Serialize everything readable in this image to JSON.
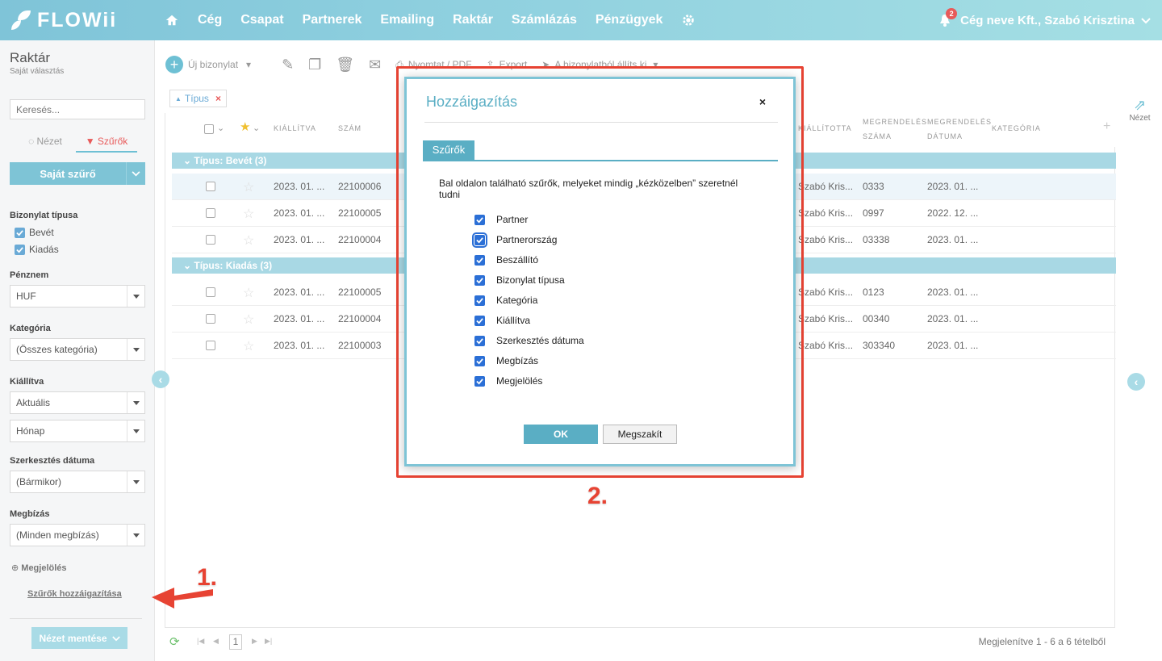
{
  "brand": {
    "name": "FLOWii",
    "accent": "#7ec4d6",
    "alert": "#e74333"
  },
  "nav": {
    "items": [
      "Cég",
      "Csapat",
      "Partnerek",
      "Emailing",
      "Raktár",
      "Számlázás",
      "Pénzügyek"
    ]
  },
  "user": {
    "label": "Cég neve Kft., Szabó Krisztina",
    "notifications": "2"
  },
  "sidebar": {
    "title": "Raktár",
    "subtitle": "Saját választás",
    "search_placeholder": "Keresés...",
    "tab_view": "Nézet",
    "tab_filters": "Szűrők",
    "own_filter": "Saját szűrő",
    "doc_type_label": "Bizonylat típusa",
    "doc_types": [
      "Bevét",
      "Kiadás"
    ],
    "currency_label": "Pénznem",
    "currency_value": "HUF",
    "category_label": "Kategória",
    "category_value": "(Összes kategória)",
    "issued_label": "Kiállítva",
    "issued_value": "Aktuális",
    "issued_period": "Hónap",
    "edit_date_label": "Szerkesztés dátuma",
    "edit_date_value": "(Bármikor)",
    "assignment_label": "Megbízás",
    "assignment_value": "(Minden megbízás)",
    "marking_label": "Megjelölés",
    "assign_link": "Szűrők hozzáigazítása",
    "save_view": "Nézet mentése"
  },
  "toolbar": {
    "new_doc": "Új bizonylat",
    "print": "Nyomtat / PDF",
    "export": "Export",
    "from_doc": "A bizonylatból állíts ki"
  },
  "grid": {
    "filter_chip": "Típus",
    "headers": {
      "issued": "KIÁLLÍTVA",
      "number": "SZÁM",
      "issued_by": "KIÁLLÍTOTTA",
      "order_no_1": "MEGRENDELÉS",
      "order_no_2": "SZÁMA",
      "order_date_1": "MEGRENDELÉS",
      "order_date_2": "DÁTUMA",
      "category": "KATEGÓRIA"
    },
    "groups": [
      {
        "label": "Típus: Bevét (3)",
        "rows": [
          {
            "date": "2023. 01. ...",
            "number": "22100006",
            "by": "Szabó Kris...",
            "order": "0333",
            "order_date": "2023. 01. ..."
          },
          {
            "date": "2023. 01. ...",
            "number": "22100005",
            "by": "Szabó Kris...",
            "order": "0997",
            "order_date": "2022. 12. ..."
          },
          {
            "date": "2023. 01. ...",
            "number": "22100004",
            "by": "Szabó Kris...",
            "order": "03338",
            "order_date": "2023. 01. ..."
          }
        ]
      },
      {
        "label": "Típus: Kiadás (3)",
        "rows": [
          {
            "date": "2023. 01. ...",
            "number": "22100005",
            "by": "Szabó Kris...",
            "order": "0123",
            "order_date": "2023. 01. ..."
          },
          {
            "date": "2023. 01. ...",
            "number": "22100004",
            "by": "Szabó Kris...",
            "order": "00340",
            "order_date": "2023. 01. ..."
          },
          {
            "date": "2023. 01. ...",
            "number": "22100003",
            "by": "Szabó Kris...",
            "order": "303340",
            "order_date": "2023. 01. ..."
          }
        ]
      }
    ],
    "page": "1",
    "summary": "Megjelenítve 1 - 6 a 6 tételből",
    "view_label": "Nézet"
  },
  "modal": {
    "title": "Hozzáigazítás",
    "close": "×",
    "tab": "Szűrők",
    "description": "Bal oldalon található szűrők, melyeket mindig „kézközelben” szeretnél tudni",
    "items": [
      "Partner",
      "Partnerország",
      "Beszállító",
      "Bizonylat típusa",
      "Kategória",
      "Kiállítva",
      "Szerkesztés dátuma",
      "Megbízás",
      "Megjelölés"
    ],
    "ok": "OK",
    "cancel": "Megszakít"
  },
  "annotations": {
    "step1": "1.",
    "step2": "2."
  }
}
